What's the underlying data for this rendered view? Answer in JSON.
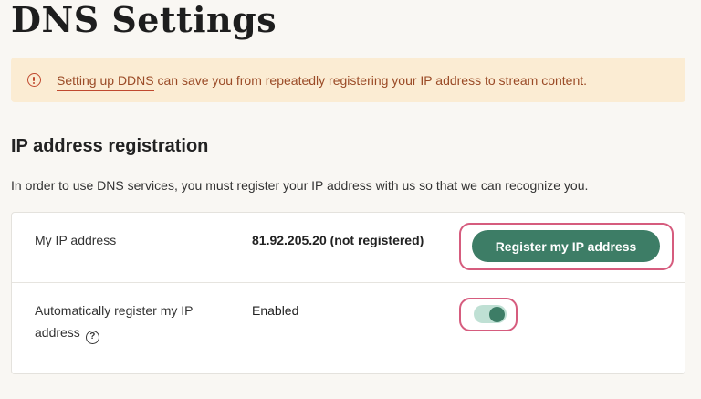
{
  "page": {
    "title": "DNS Settings"
  },
  "notice": {
    "link_text": "Setting up DDNS",
    "text": " can save you from repeatedly registering your IP address to stream content."
  },
  "section": {
    "title": "IP address registration",
    "description": "In order to use DNS services, you must register your IP address with us so that we can recognize you."
  },
  "rows": {
    "ip": {
      "label": "My IP address",
      "value": "81.92.205.20 (not registered)",
      "button_label": "Register my IP address"
    },
    "auto": {
      "label_line1": "Automatically register my IP",
      "label_line2": "address",
      "help_glyph": "?",
      "value": "Enabled",
      "toggle_on": true
    }
  },
  "colors": {
    "accent": "#3d7d66",
    "notice_bg": "#fbecd3",
    "notice_text": "#9a4a26",
    "highlight": "#d65c7e",
    "background": "#f9f7f3"
  },
  "icons": {
    "notice": "alert-circle-icon",
    "help": "help-circle-icon"
  }
}
